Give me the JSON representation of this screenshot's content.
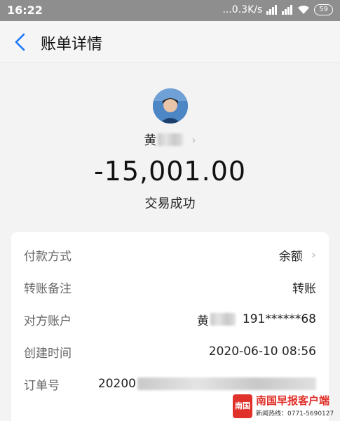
{
  "status_bar": {
    "time": "16:22",
    "network_speed": "...0.3K/s",
    "battery": "59"
  },
  "nav": {
    "title": "账单详情"
  },
  "payee": {
    "name_visible": "黄",
    "name_masked": true
  },
  "amount": "-15,001.00",
  "trade_status": "交易成功",
  "details": {
    "payment_method": {
      "label": "付款方式",
      "value": "余额"
    },
    "transfer_note": {
      "label": "转账备注",
      "value": "转账"
    },
    "counterparty": {
      "label": "对方账户",
      "name_prefix": "黄",
      "account": "191******68"
    },
    "created_time": {
      "label": "创建时间",
      "value": "2020-06-10 08:56"
    },
    "order_no": {
      "label": "订单号",
      "value_prefix": "20200"
    }
  },
  "watermark": {
    "logo_text": "南国",
    "name": "南国早报客户端",
    "phone": "新闻热线：0771-5690127"
  },
  "colors": {
    "accent": "#1677ff",
    "watermark_red": "#e0312a"
  }
}
